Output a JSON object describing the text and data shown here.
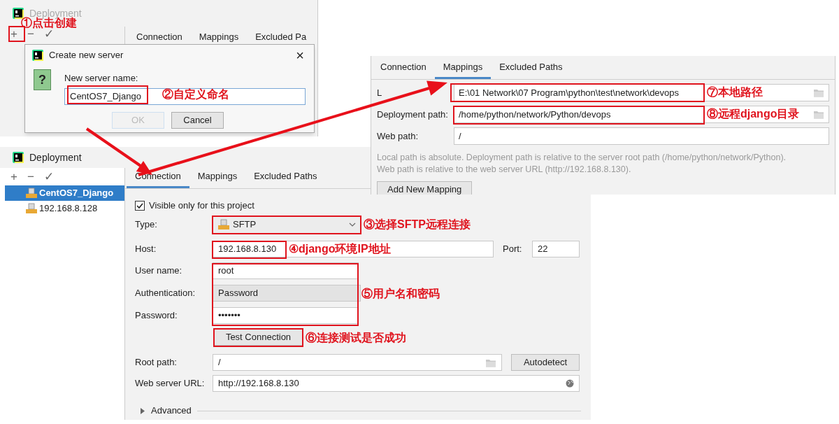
{
  "top_left_screenshot": {
    "window_title": "Deployment",
    "toolbar": [
      "+",
      "−",
      "✓"
    ],
    "tabs": [
      "Connection",
      "Mappings",
      "Excluded Pa"
    ],
    "dialog": {
      "title": "Create new server",
      "close": "×",
      "icon": "?",
      "label": "New server name:",
      "value": "CentOS7_Django",
      "buttons": [
        {
          "label": "OK",
          "disabled": true
        },
        {
          "label": "Cancel",
          "disabled": false
        }
      ]
    }
  },
  "mappings_screenshot": {
    "tabs": [
      {
        "label": "Connection",
        "selected": false
      },
      {
        "label": "Mappings",
        "selected": true
      },
      {
        "label": "Excluded Paths",
        "selected": false
      }
    ],
    "fields": [
      {
        "label_parts": [
          "L"
        ],
        "value": "E:\\01 Network\\07 Program\\python\\test\\network\\devops",
        "browse": true
      },
      {
        "label_parts": [
          "Deployment path:"
        ],
        "value": "/home/python/network/Python/devops",
        "browse": true
      },
      {
        "label_parts": [
          "Web path:"
        ],
        "value": "/",
        "browse": false
      }
    ],
    "note": [
      "Local path is absolute. Deployment path is relative to the server root path (/home/python/network/Python).",
      "Web path is relative to the web server URL (http://192.168.8.130)."
    ],
    "button": "Add New Mapping"
  },
  "deployment_screenshot": {
    "window_title": "Deployment",
    "toolbar": [
      "+",
      "−",
      "✓"
    ],
    "servers": [
      {
        "name": "CentOS7_Django",
        "selected": true
      },
      {
        "name": "192.168.8.128",
        "selected": false
      }
    ],
    "tabs": [
      {
        "label": "Connection",
        "selected": true
      },
      {
        "label": "Mappings",
        "selected": false
      },
      {
        "label": "Excluded Paths",
        "selected": false
      }
    ],
    "visible_only": {
      "label": "Visible only for this project",
      "checked": true
    },
    "type": {
      "label": "Type:",
      "value": "SFTP"
    },
    "host": {
      "label": "Host:",
      "value": "192.168.8.130"
    },
    "port": {
      "label": "Port:",
      "value": "22"
    },
    "user_name": {
      "label": "User name:",
      "value": "root"
    },
    "authentication": {
      "label": "Authentication:",
      "value": "Password"
    },
    "password": {
      "label": "Password:",
      "value": "•••••••"
    },
    "test_button": "Test Connection",
    "root_path": {
      "label": "Root path:",
      "value": "/"
    },
    "autodetect_button": "Autodetect",
    "web_server_url": {
      "label": "Web server URL:",
      "value": "http://192.168.8.130"
    },
    "advanced": {
      "label": "Advanced",
      "expanded": false
    }
  },
  "annotations": [
    "①点击创建",
    "②自定义命名",
    "③选择SFTP远程连接",
    "④django环境IP地址",
    "⑤用户名和密码",
    "⑥连接测试是否成功",
    "⑦本地路径",
    "⑧远程django目录"
  ]
}
